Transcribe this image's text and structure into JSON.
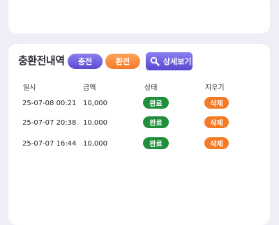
{
  "history": {
    "title": "충환전내역",
    "charge_label": "충전",
    "exchange_label": "환전",
    "detail_label": "상세보기",
    "columns": [
      "일시",
      "금액",
      "상태",
      "지우기"
    ],
    "rows": [
      {
        "datetime": "25-07-08 00:21",
        "amount": "10,000",
        "status": "완료",
        "delete_label": "삭제"
      },
      {
        "datetime": "25-07-07 20:38",
        "amount": "10,000",
        "status": "완료",
        "delete_label": "삭제"
      },
      {
        "datetime": "25-07-07 16:44",
        "amount": "10,000",
        "status": "완료",
        "delete_label": "삭제"
      }
    ]
  },
  "colors": {
    "background": "#eeeff6",
    "charge_button": "#6a5ae0",
    "exchange_button": "#f6792b",
    "status_done": "#1f8f3a",
    "delete_button": "#f47a24"
  },
  "icons": {
    "detail": "search-icon"
  }
}
